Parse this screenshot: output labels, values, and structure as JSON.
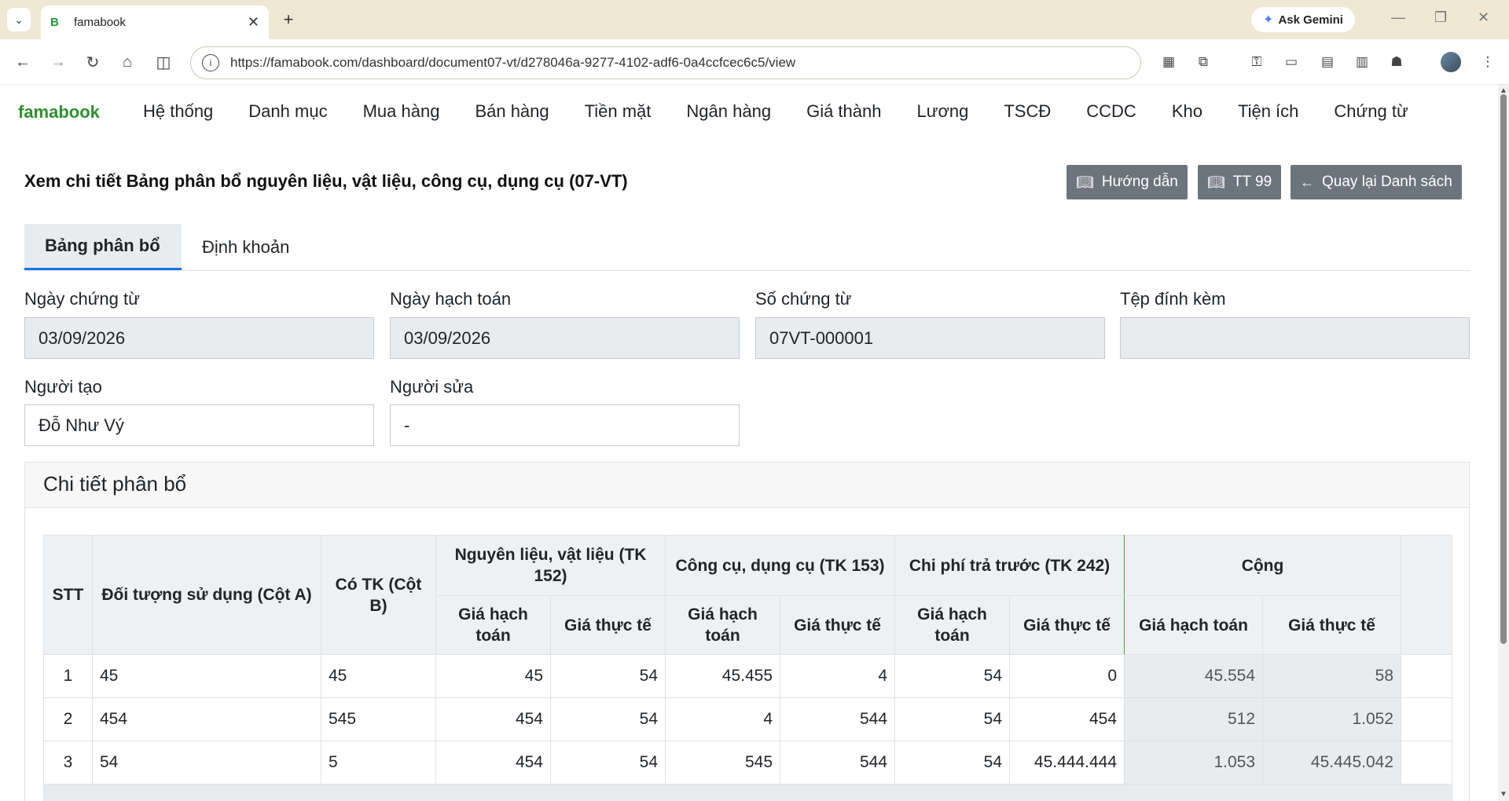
{
  "browser": {
    "tab_title": "famabook",
    "tab_favicon": "B",
    "url": "https://famabook.com/dashboard/document07-vt/d278046a-9277-4102-adf6-0a4ccfcec6c5/view",
    "gemini_label": "Ask Gemini"
  },
  "app": {
    "brand": "famabook",
    "menu": [
      "Hệ thống",
      "Danh mục",
      "Mua hàng",
      "Bán hàng",
      "Tiền mặt",
      "Ngân hàng",
      "Giá thành",
      "Lương",
      "TSCĐ",
      "CCDC",
      "Kho",
      "Tiện ích",
      "Chứng từ"
    ]
  },
  "page": {
    "title": "Xem chi tiết Bảng phân bổ nguyên liệu, vật liệu, công cụ, dụng cụ (07-VT)",
    "buttons": {
      "guide": "Hướng dẫn",
      "tt99": "TT 99",
      "back": "Quay lại Danh sách"
    },
    "tabs": [
      "Bảng phân bổ",
      "Định khoản"
    ]
  },
  "form": {
    "doc_date_label": "Ngày chứng từ",
    "doc_date": "03/09/2026",
    "post_date_label": "Ngày hạch toán",
    "post_date": "03/09/2026",
    "doc_no_label": "Số chứng từ",
    "doc_no": "07VT-000001",
    "attach_label": "Tệp đính kèm",
    "attach": "",
    "creator_label": "Người tạo",
    "creator": "Đỗ Như Vý",
    "editor_label": "Người sửa",
    "editor": "-"
  },
  "card": {
    "title": "Chi tiết phân bổ"
  },
  "table": {
    "headers": {
      "stt": "STT",
      "object": "Đối tượng sử dụng (Cột A)",
      "credit": "Có TK (Cột B)",
      "g152": "Nguyên liệu, vật liệu (TK 152)",
      "g153": "Công cụ, dụng cụ (TK 153)",
      "g242": "Chi phí trả trước (TK 242)",
      "gsum": "Cộng",
      "accounting_price": "Giá hạch toán",
      "actual_price": "Giá thực tế"
    },
    "rows": [
      {
        "stt": "1",
        "object": "45",
        "credit": "45",
        "a152": "45",
        "r152": "54",
        "a153": "45.455",
        "r153": "4",
        "a242": "54",
        "r242": "0",
        "asum": "45.554",
        "rsum": "58"
      },
      {
        "stt": "2",
        "object": "454",
        "credit": "545",
        "a152": "454",
        "r152": "54",
        "a153": "4",
        "r153": "544",
        "a242": "54",
        "r242": "454",
        "asum": "512",
        "rsum": "1.052"
      },
      {
        "stt": "3",
        "object": "54",
        "credit": "5",
        "a152": "454",
        "r152": "54",
        "a153": "545",
        "r153": "544",
        "a242": "54",
        "r242": "45.444.444",
        "asum": "1.053",
        "rsum": "45.445.042"
      }
    ]
  }
}
